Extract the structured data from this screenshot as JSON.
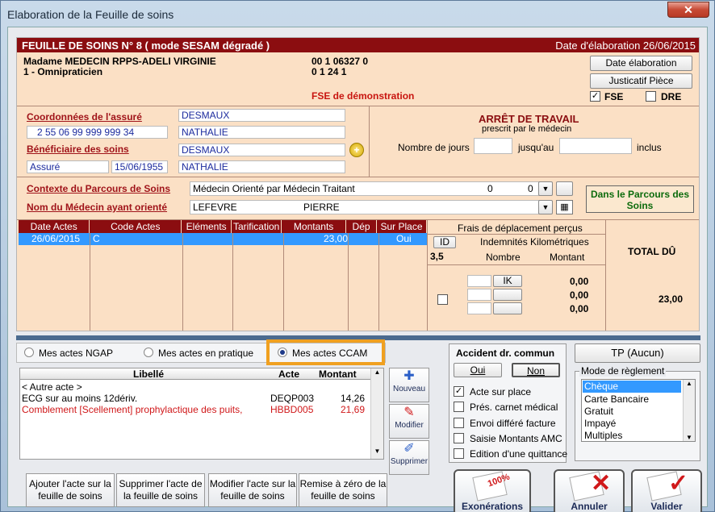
{
  "window": {
    "title": "Elaboration de la Feuille de soins",
    "close": "✕"
  },
  "header": {
    "title": "FEUILLE DE SOINS  N° 8 ( mode SESAM dégradé )",
    "date_elab": "Date d'élaboration 26/06/2015"
  },
  "doctor": {
    "name": "Madame MEDECIN RPPS-ADELI VIRGINIE",
    "specialty": "1 - Omnipraticien",
    "id1": "00 1 06327 0",
    "id2": "0 1 24 1",
    "demo": "FSE de démonstration"
  },
  "buttons": {
    "date_elab": "Date élaboration",
    "justif": "Justicatif Pièce",
    "fse": "FSE",
    "dre": "DRE"
  },
  "assure": {
    "coord_label": "Coordonnées de l'assuré",
    "nir": "2 55 06 99 999 999 34",
    "nom": "DESMAUX",
    "prenom": "NATHALIE",
    "benef_label": "Bénéficiaire des soins",
    "benef_nom": "DESMAUX",
    "benef_prenom": "NATHALIE",
    "qualite": "Assuré",
    "naissance": "15/06/1955"
  },
  "arret": {
    "title": "ARRÊT DE TRAVAIL",
    "subtitle": "prescrit par le médecin",
    "nb_jours": "Nombre de jours",
    "jusqu": "jusqu'au",
    "inclus": "inclus"
  },
  "parcours": {
    "contexte_label": "Contexte du Parcours de Soins",
    "contexte_value": "Médecin Orienté par Médecin Traitant",
    "v1": "0",
    "v2": "0",
    "medecin_label": "Nom du Médecin ayant orienté",
    "medecin_nom": "LEFEVRE",
    "medecin_prenom": "PIERRE",
    "status": "Dans le Parcours des Soins"
  },
  "actes": {
    "headers": [
      "Date Actes",
      "Code Actes",
      "Eléments",
      "Tarification",
      "Montants",
      "Dép",
      "Sur Place"
    ],
    "row": [
      "26/06/2015",
      "C",
      "",
      "",
      "23,00",
      "",
      "Oui"
    ]
  },
  "frais": {
    "title": "Frais de déplacement perçus",
    "id": "ID",
    "ik_title": "Indemnités Kilométriques",
    "val": "3,5",
    "nombre": "Nombre",
    "montant": "Montant",
    "ik": "IK",
    "m1": "0,00",
    "m2": "0,00",
    "m3": "0,00",
    "total_label": "TOTAL DÛ",
    "total": "23,00"
  },
  "tabs": {
    "ngap": "Mes actes NGAP",
    "pratique": "Mes actes en pratique",
    "ccam": "Mes actes CCAM"
  },
  "list": {
    "headers": [
      "Libellé",
      "Acte",
      "Montant"
    ],
    "rows": [
      {
        "lib": "< Autre acte >",
        "acte": "",
        "montant": ""
      },
      {
        "lib": "ECG sur au moins 12dériv.",
        "acte": "DEQP003",
        "montant": "14,26"
      },
      {
        "lib": "Comblement [Scellement] prophylactique des puits,",
        "acte": "HBBD005",
        "montant": "21,69"
      }
    ]
  },
  "side": {
    "nouveau": "Nouveau",
    "modifier": "Modifier",
    "supprimer": "Supprimer"
  },
  "foot": {
    "b1": "Ajouter l'acte sur la feuille de soins",
    "b2": "Supprimer l'acte de la feuille de soins",
    "b3": "Modifier l'acte sur la feuille de soins",
    "b4": "Remise à zéro de la feuille de soins"
  },
  "accident": {
    "title": "Accident dr. commun",
    "oui": "Oui",
    "non": "Non"
  },
  "options": [
    {
      "label": "Acte sur place",
      "checked": true
    },
    {
      "label": "Prés. carnet médical",
      "checked": false
    },
    {
      "label": "Envoi différé facture",
      "checked": false
    },
    {
      "label": "Saisie Montants AMC",
      "checked": false
    },
    {
      "label": "Edition d'une quittance",
      "checked": false
    }
  ],
  "reglement": {
    "tp": "TP (Aucun)",
    "title": "Mode de règlement",
    "items": [
      "Chèque",
      "Carte Bancaire",
      "Gratuit",
      "Impayé",
      "Multiples"
    ]
  },
  "actions": {
    "exo": "Exonérations",
    "annuler": "Annuler",
    "valider": "Valider",
    "stamp": "100%"
  }
}
